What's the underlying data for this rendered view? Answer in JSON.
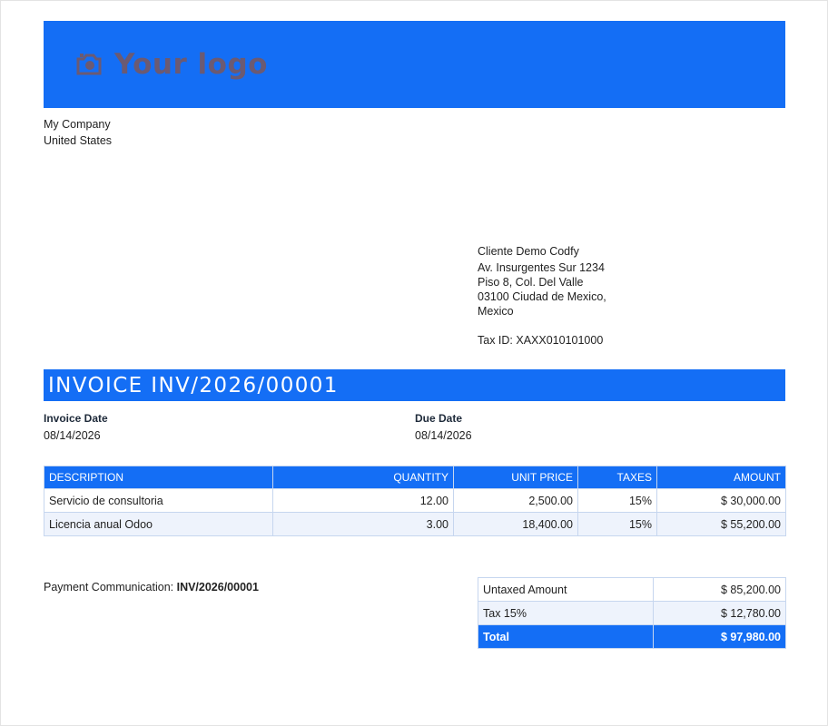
{
  "logo": {
    "icon": "camera-icon",
    "text": "Your logo"
  },
  "company": {
    "name": "My Company",
    "country": "United States"
  },
  "client": {
    "name": "Cliente Demo Codfy",
    "address1": "Av. Insurgentes Sur 1234",
    "address2": "Piso 8, Col. Del Valle",
    "address3": "03100 Ciudad de Mexico,",
    "country": "Mexico",
    "tax_id": "Tax ID: XAXX010101000"
  },
  "invoice": {
    "title": "INVOICE INV/2026/00001",
    "invoice_date_label": "Invoice Date",
    "invoice_date": "08/14/2026",
    "due_date_label": "Due Date",
    "due_date": "08/14/2026"
  },
  "lines": {
    "headers": [
      "DESCRIPTION",
      "QUANTITY",
      "UNIT PRICE",
      "TAXES",
      "AMOUNT"
    ],
    "rows": [
      [
        "Servicio de consultoria",
        "12.00",
        "2,500.00",
        "15%",
        "$ 30,000.00"
      ],
      [
        "Licencia anual Odoo",
        "3.00",
        "18,400.00",
        "15%",
        "$ 55,200.00"
      ]
    ]
  },
  "payment": {
    "label": "Payment Communication: ",
    "reference": "INV/2026/00001"
  },
  "totals": {
    "untaxed_label": "Untaxed Amount",
    "untaxed_value": "$ 85,200.00",
    "tax_label": "Tax 15%",
    "tax_value": "$ 12,780.00",
    "total_label": "Total",
    "total_value": "$ 97,980.00"
  },
  "colors": {
    "accent": "#146ef5",
    "row_alt": "#eef3fc",
    "logo_text": "#6b5a73"
  }
}
